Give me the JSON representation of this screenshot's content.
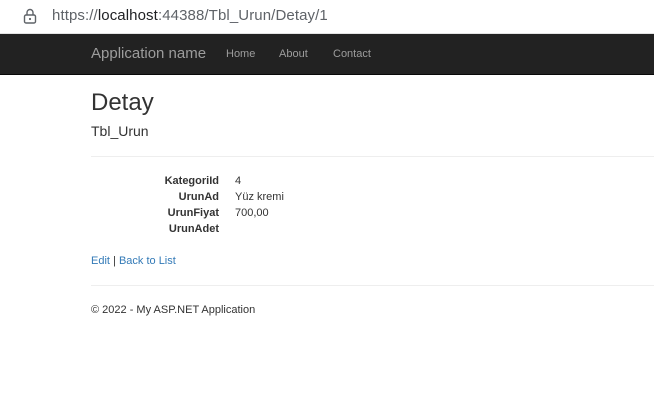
{
  "browser": {
    "url_scheme": "https://",
    "url_host": "localhost",
    "url_rest": ":44388/Tbl_Urun/Detay/1"
  },
  "navbar": {
    "brand": "Application name",
    "links": [
      "Home",
      "About",
      "Contact"
    ]
  },
  "main": {
    "title": "Detay",
    "subtitle": "Tbl_Urun",
    "details": [
      {
        "label": "KategoriId",
        "value": "4"
      },
      {
        "label": "UrunAd",
        "value": "Yüz kremi"
      },
      {
        "label": "UrunFiyat",
        "value": "700,00"
      },
      {
        "label": "UrunAdet",
        "value": ""
      }
    ],
    "edit_link": "Edit",
    "separator": "|",
    "back_link": "Back to List"
  },
  "footer": {
    "text": "© 2022 - My ASP.NET Application"
  },
  "colors": {
    "navbar_bg": "#222222",
    "nav_text": "#9d9d9d",
    "link": "#337ab7"
  }
}
